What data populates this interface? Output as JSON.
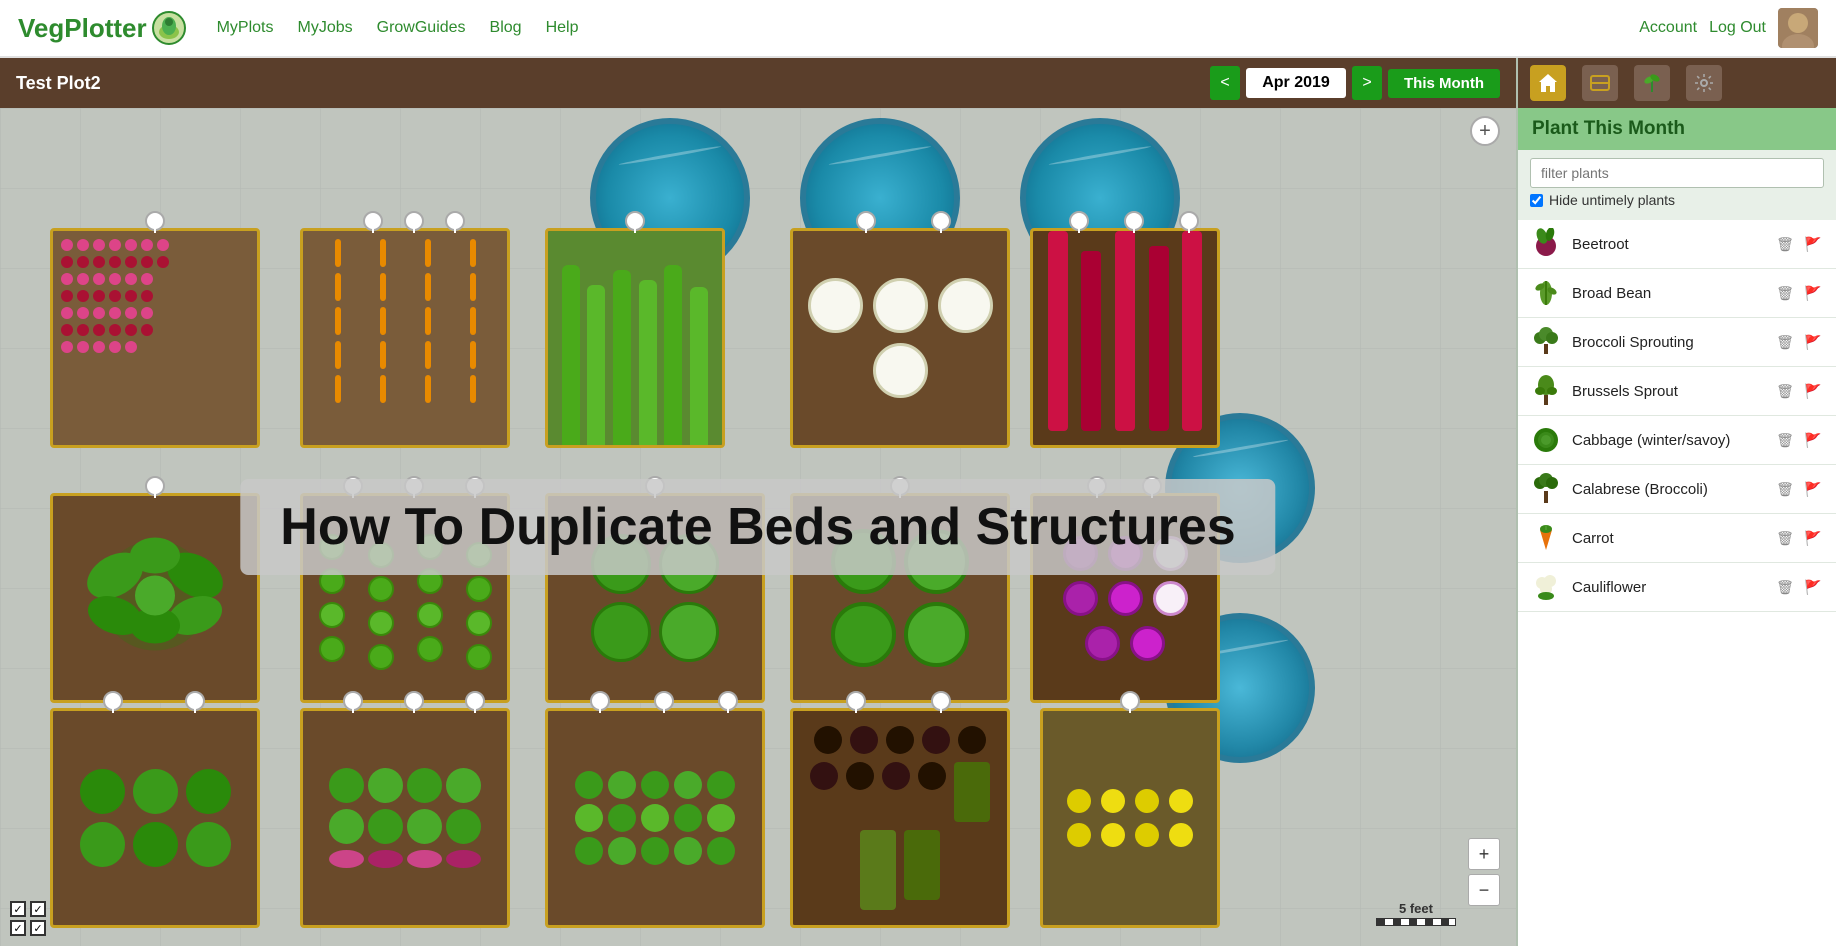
{
  "nav": {
    "logo": "VegPlotter",
    "links": [
      "MyPlots",
      "MyJobs",
      "GrowGuides",
      "Blog",
      "Help"
    ],
    "right_links": [
      "Account",
      "Log Out"
    ]
  },
  "plot": {
    "title": "Test Plot2",
    "date": "Apr 2019",
    "this_month": "This Month",
    "prev_btn": "<",
    "next_btn": ">"
  },
  "overlay": {
    "text": "How To Duplicate Beds and Structures"
  },
  "sidebar": {
    "title": "Plant This Month",
    "filter_placeholder": "filter plants",
    "hide_untimely_label": "Hide untimely plants",
    "plants": [
      {
        "name": "Beetroot",
        "icon": "🟣"
      },
      {
        "name": "Broad Bean",
        "icon": "🟢"
      },
      {
        "name": "Broccoli Sprouting",
        "icon": "🥦"
      },
      {
        "name": "Brussels Sprout",
        "icon": "🌿"
      },
      {
        "name": "Cabbage (winter/savoy)",
        "icon": "🥬"
      },
      {
        "name": "Calabrese (Broccoli)",
        "icon": "🥦"
      },
      {
        "name": "Carrot",
        "icon": "🥕"
      },
      {
        "name": "Cauliflower",
        "icon": "⚪"
      }
    ]
  },
  "toolbar": {
    "home_icon": "🏠",
    "bed_icon": "📦",
    "plant_icon": "🌱",
    "settings_icon": "⚙️"
  },
  "zoom": {
    "in": "+",
    "out": "−"
  },
  "scale": {
    "label": "5 feet"
  }
}
